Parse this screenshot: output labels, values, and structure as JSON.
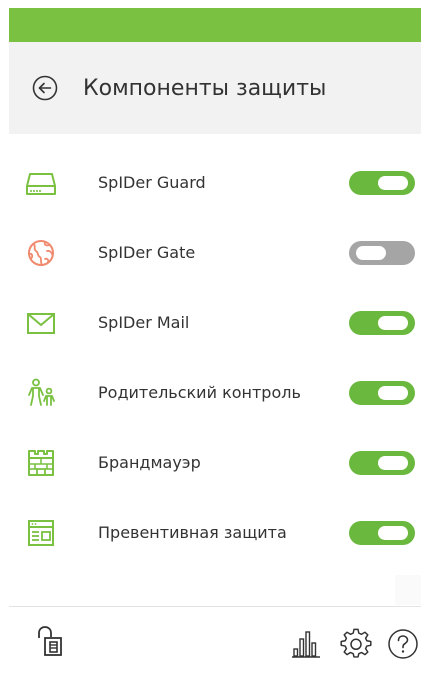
{
  "header": {
    "title": "Компоненты защиты",
    "back_icon": "arrow-left-circle-icon"
  },
  "components": [
    {
      "key": "spider-guard",
      "label": "SpIDer Guard",
      "icon": "hard-drive-icon",
      "enabled": true,
      "icon_color": "#7ac142"
    },
    {
      "key": "spider-gate",
      "label": "SpIDer Gate",
      "icon": "globe-icon",
      "enabled": false,
      "icon_color": "#f08a6e"
    },
    {
      "key": "spider-mail",
      "label": "SpIDer Mail",
      "icon": "envelope-icon",
      "enabled": true,
      "icon_color": "#7ac142"
    },
    {
      "key": "parental-control",
      "label": "Родительский контроль",
      "icon": "parent-child-icon",
      "enabled": true,
      "icon_color": "#7ac142"
    },
    {
      "key": "firewall",
      "label": "Брандмауэр",
      "icon": "castle-wall-icon",
      "enabled": true,
      "icon_color": "#7ac142"
    },
    {
      "key": "preventive",
      "label": "Превентивная защита",
      "icon": "window-shield-icon",
      "enabled": true,
      "icon_color": "#7ac142"
    }
  ],
  "footer": {
    "lock_icon": "unlocked-padlock-icon",
    "stats_icon": "bar-chart-icon",
    "settings_icon": "gear-icon",
    "help_icon": "question-circle-icon"
  },
  "colors": {
    "accent": "#7ac142",
    "toggle_on": "#6ab83e",
    "toggle_off": "#a5a5a5",
    "header_bg": "#f2f2f2"
  }
}
